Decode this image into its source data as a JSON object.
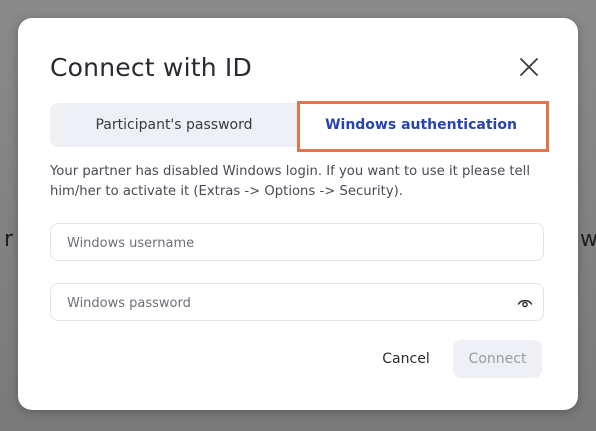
{
  "background": {
    "left_fragment": "r",
    "right_fragment": "w"
  },
  "dialog": {
    "title": "Connect with ID",
    "close_icon": "close-icon",
    "tabs": [
      {
        "label": "Participant's password",
        "active": false
      },
      {
        "label": "Windows authentication",
        "active": true
      }
    ],
    "message": "Your partner has disabled Windows login. If you want to use it please tell him/her to activate it (Extras -> Options -> Security).",
    "username": {
      "placeholder": "Windows username",
      "value": ""
    },
    "password": {
      "placeholder": "Windows password",
      "value": "",
      "toggle_icon": "eye-icon"
    },
    "buttons": {
      "cancel": "Cancel",
      "connect": "Connect"
    }
  },
  "colors": {
    "active_tab_text": "#2743b0",
    "highlight_border": "#e0764a",
    "disabled_button_bg": "#eef0f5",
    "disabled_button_text": "#9a9aa4"
  }
}
